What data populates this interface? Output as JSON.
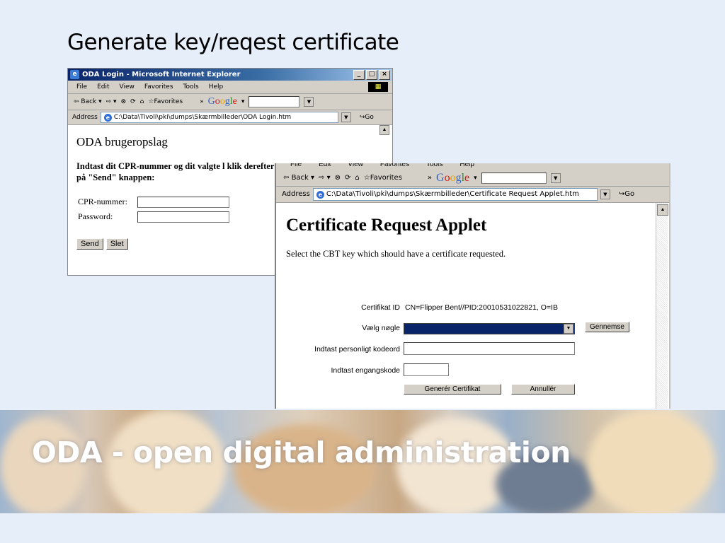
{
  "slide": {
    "title": "Generate key/reqest certificate",
    "banner_text": "ODA - open digital administration"
  },
  "window1": {
    "title": "ODA Login - Microsoft Internet Explorer",
    "menu": [
      "File",
      "Edit",
      "View",
      "Favorites",
      "Tools",
      "Help"
    ],
    "toolbar": {
      "back": "Back",
      "favorites": "Favorites",
      "more": "»"
    },
    "google_label": "Google",
    "address_label": "Address",
    "address_value": "C:\\Data\\Tivoli\\pki\\dumps\\Skærmbilleder\\ODA Login.htm",
    "go_label": "Go",
    "heading": "ODA brugeropslag",
    "instruction": "Indtast dit CPR-nummer og dit valgte l klik derefter på \"Send\" knappen:",
    "cpr_label": "CPR-nummer:",
    "password_label": "Password:",
    "send_button": "Send",
    "clear_button": "Slet"
  },
  "window2": {
    "menu": [
      "File",
      "Edit",
      "View",
      "Favorites",
      "Tools",
      "Help"
    ],
    "toolbar": {
      "back": "Back",
      "favorites": "Favorites",
      "more": "»"
    },
    "google_label": "Google",
    "address_label": "Address",
    "address_value": "C:\\Data\\Tivoli\\pki\\dumps\\Skærmbilleder\\Certificate Request Applet.htm",
    "go_label": "Go",
    "heading": "Certificate Request Applet",
    "subtitle": "Select the CBT key which should have a certificate requested.",
    "cert_id_label": "Certifikat ID",
    "cert_id_value": "CN=Flipper Bent//PID:20010531022821, O=IB",
    "choose_key_label": "Vælg nøgle",
    "browse_button": "Gennemse",
    "personal_code_label": "Indtast personligt kodeord",
    "one_time_code_label": "Indtast engangskode",
    "generate_button": "Generér Certifikat",
    "cancel_button": "Annullér"
  }
}
